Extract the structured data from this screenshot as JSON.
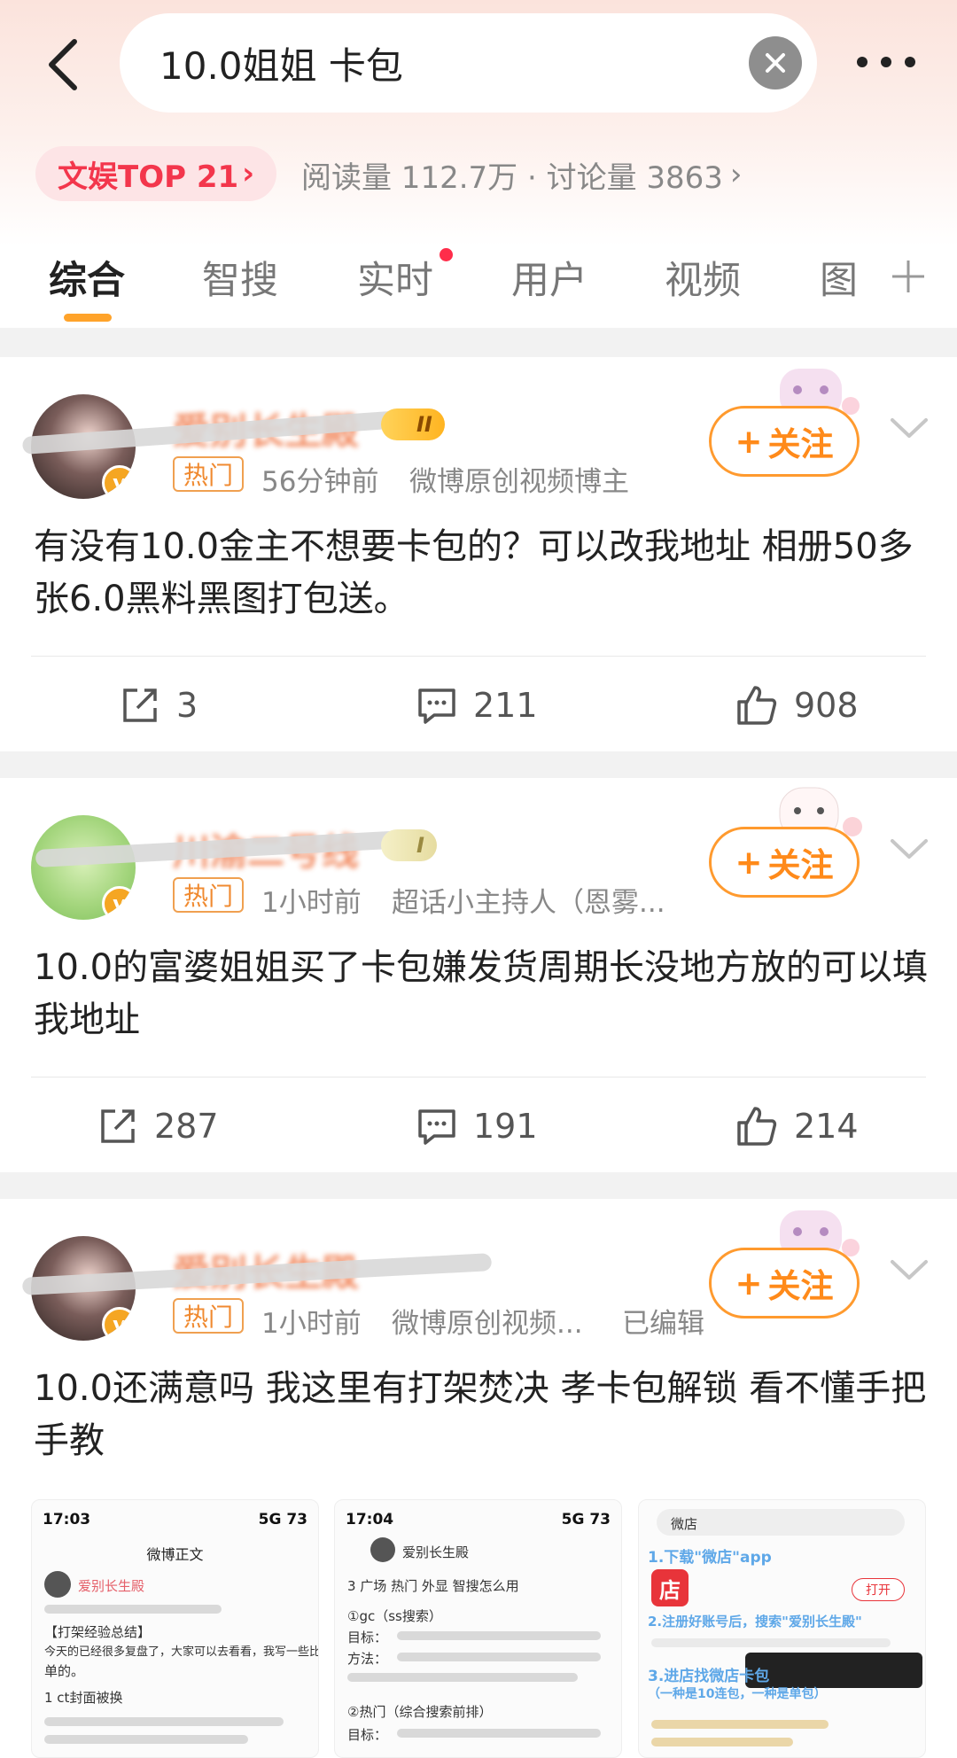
{
  "header": {
    "search_value": "10.0姐姐 卡包",
    "back_icon": "back-arrow-icon",
    "clear_icon": "clear-x-icon",
    "more_icon": "more-dots-icon"
  },
  "topic": {
    "rank_label": "文娱TOP 21",
    "rank_arrow": "›",
    "stats": "阅读量 112.7万 · 讨论量 3863",
    "stats_arrow": "›"
  },
  "tabs": [
    {
      "label": "综合",
      "active": true
    },
    {
      "label": "智搜"
    },
    {
      "label": "实时"
    },
    {
      "label": "用户"
    },
    {
      "label": "视频"
    },
    {
      "label": "图"
    }
  ],
  "posts": [
    {
      "username": "爱别长生殿",
      "level": "II",
      "hot_tag": "热门",
      "time": "56分钟前",
      "source": "微博原创视频博主",
      "follow": "关注",
      "text": "有没有10.0金主不想要卡包的？可以改我地址 相册50多张6.0黑料黑图打包送。",
      "reposts": "3",
      "comments": "211",
      "likes": "908"
    },
    {
      "username": "川渝二号线",
      "level": "I",
      "hot_tag": "热门",
      "time": "1小时前",
      "source": "超话小主持人（恩雾...",
      "follow": "关注",
      "text": "10.0的富婆姐姐买了卡包嫌发货周期长没地方放的可以填我地址",
      "reposts": "287",
      "comments": "191",
      "likes": "214"
    },
    {
      "username": "爱别长生殿",
      "hot_tag": "热门",
      "time": "1小时前",
      "source": "微博原创视频...",
      "edited": "已编辑",
      "follow": "关注",
      "text": "10.0还满意吗 我这里有打架焚决 孝卡包解锁 看不懂手把手教"
    }
  ],
  "thumbnails": [
    {
      "time": "17:03",
      "net": "5G 73",
      "title": "微博正文",
      "name": "爱别长生殿",
      "line1": "【打架经验总结】",
      "line2": "今天的已经很多复盘了，大家可以去看看，我写一些比较简",
      "line3": "单的。",
      "line4": "1 ct封面被换"
    },
    {
      "time": "17:04",
      "net": "5G 73",
      "name": "爱别长生殿",
      "line1": "3 广场 热门 外显 智搜怎么用",
      "line2": "①gc（ss搜索）",
      "line3": "目标：",
      "line4": "方法：",
      "line5": "②热门（综合搜索前排）",
      "line6": "目标："
    },
    {
      "search": "微店",
      "step1": "1.下载\"微店\"app",
      "step2": "2.注册好账号后，搜索\"爱别长生殿\"",
      "step3": "3.进店找微店卡包",
      "step3b": "（一种是10连包，一种是单包）",
      "open": "打开"
    }
  ],
  "colors": {
    "accent": "#ff8a1a",
    "hot_red": "#f3364c",
    "tab_underline": "#ffa32a"
  }
}
